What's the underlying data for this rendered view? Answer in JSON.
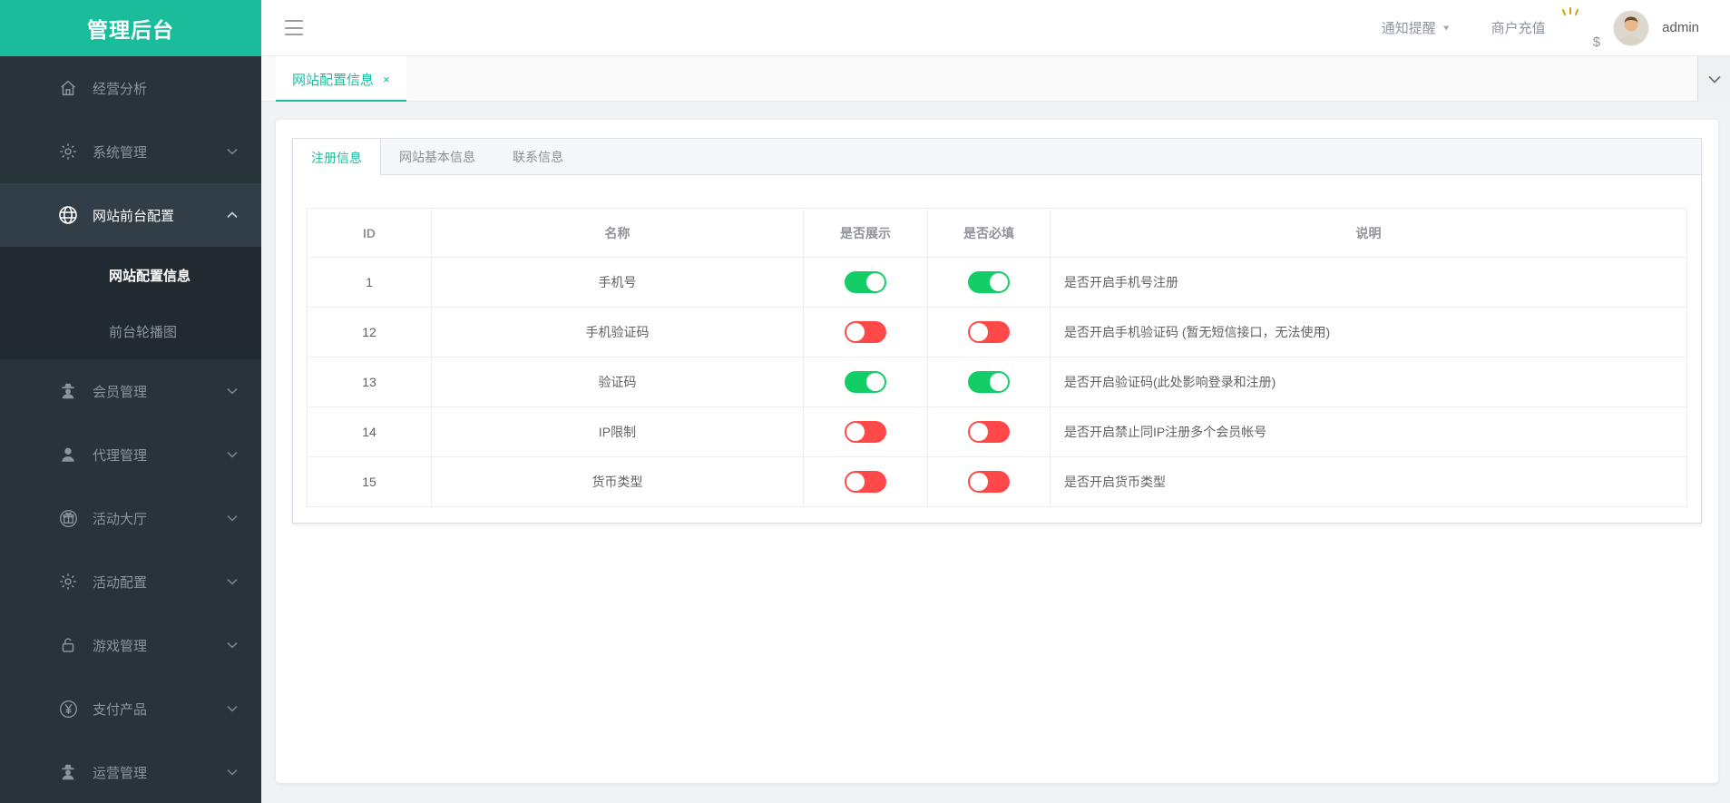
{
  "app": {
    "logo_title": "管理后台"
  },
  "topbar": {
    "notice_label": "通知提醒",
    "recharge_label": "商户充值",
    "username": "admin"
  },
  "route_tabs": {
    "active_tab": "网站配置信息",
    "close_glyph": "×"
  },
  "sidebar": {
    "items": [
      {
        "label": "经营分析",
        "icon": "home-icon",
        "expandable": false,
        "active": false
      },
      {
        "label": "系统管理",
        "icon": "gear-icon",
        "expandable": true,
        "active": false
      },
      {
        "label": "网站前台配置",
        "icon": "globe-icon",
        "expandable": true,
        "active": true,
        "expanded": true,
        "children": [
          {
            "label": "网站配置信息",
            "active": true
          },
          {
            "label": "前台轮播图",
            "active": false
          }
        ]
      },
      {
        "label": "会员管理",
        "icon": "member-spy-icon",
        "expandable": true,
        "active": false
      },
      {
        "label": "代理管理",
        "icon": "person-icon",
        "expandable": true,
        "active": false
      },
      {
        "label": "活动大厅",
        "icon": "gift-icon",
        "expandable": true,
        "active": false
      },
      {
        "label": "活动配置",
        "icon": "gear-icon",
        "expandable": true,
        "active": false
      },
      {
        "label": "游戏管理",
        "icon": "lock-open-icon",
        "expandable": true,
        "active": false
      },
      {
        "label": "支付产品",
        "icon": "yen-circle-icon",
        "expandable": true,
        "active": false
      },
      {
        "label": "运营管理",
        "icon": "member-spy-icon",
        "expandable": true,
        "active": false
      }
    ]
  },
  "card_tabs": [
    {
      "label": "注册信息",
      "active": true
    },
    {
      "label": "网站基本信息",
      "active": false
    },
    {
      "label": "联系信息",
      "active": false
    }
  ],
  "table": {
    "columns": [
      "ID",
      "名称",
      "是否展示",
      "是否必填",
      "说明"
    ],
    "rows": [
      {
        "id": "1",
        "name": "手机号",
        "show": true,
        "required": true,
        "desc": "是否开启手机号注册"
      },
      {
        "id": "12",
        "name": "手机验证码",
        "show": false,
        "required": false,
        "desc": "是否开启手机验证码 (暂无短信接口，无法使用)"
      },
      {
        "id": "13",
        "name": "验证码",
        "show": true,
        "required": true,
        "desc": "是否开启验证码(此处影响登录和注册)"
      },
      {
        "id": "14",
        "name": "IP限制",
        "show": false,
        "required": false,
        "desc": "是否开启禁止同IP注册多个会员帐号"
      },
      {
        "id": "15",
        "name": "货币类型",
        "show": false,
        "required": false,
        "desc": "是否开启货币类型"
      }
    ]
  },
  "colors": {
    "brand_teal": "#1abc9c",
    "switch_on": "#13ce66",
    "switch_off": "#ff4949",
    "sidebar_bg": "#29333a"
  }
}
